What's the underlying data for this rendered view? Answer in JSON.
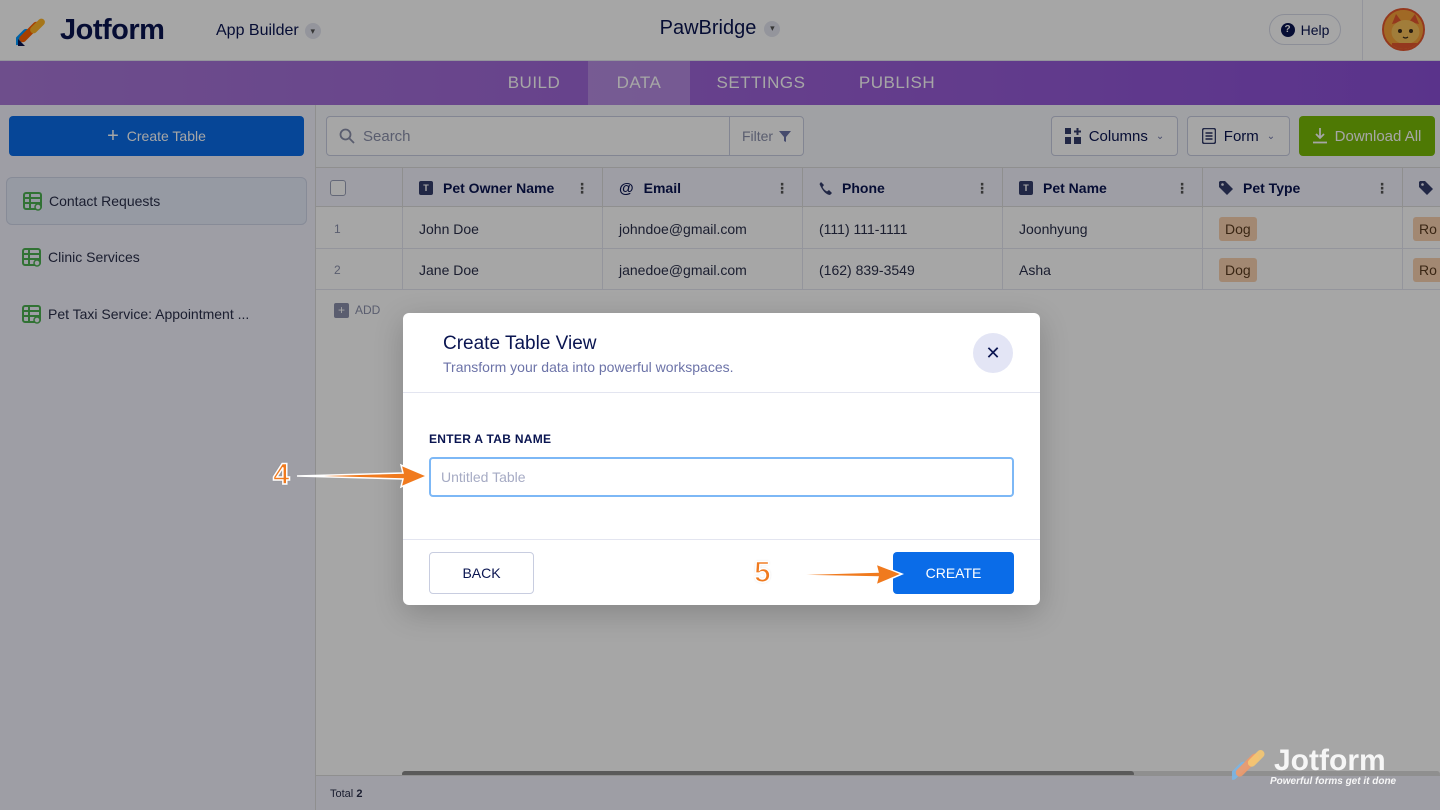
{
  "header": {
    "logo_text": "Jotform",
    "app_builder_label": "App Builder",
    "app_title": "PawBridge",
    "help_label": "Help"
  },
  "nav": {
    "tabs": [
      {
        "label": "BUILD"
      },
      {
        "label": "DATA"
      },
      {
        "label": "SETTINGS"
      },
      {
        "label": "PUBLISH"
      }
    ],
    "active": "DATA"
  },
  "sidebar": {
    "create_table_label": "Create Table",
    "items": [
      {
        "label": "Contact Requests"
      },
      {
        "label": "Clinic Services"
      },
      {
        "label": "Pet Taxi Service: Appointment ..."
      }
    ]
  },
  "toolbar": {
    "search_placeholder": "Search",
    "filter_label": "Filter",
    "columns_label": "Columns",
    "form_label": "Form",
    "download_label": "Download All"
  },
  "table": {
    "columns": [
      {
        "label": "Pet Owner Name",
        "icon": "text-type-icon"
      },
      {
        "label": "Email",
        "icon": "at-icon"
      },
      {
        "label": "Phone",
        "icon": "phone-icon"
      },
      {
        "label": "Pet Name",
        "icon": "text-type-icon"
      },
      {
        "label": "Pet Type",
        "icon": "tag-icon"
      }
    ],
    "rows": [
      {
        "num": "1",
        "owner": "John Doe",
        "email": "johndoe@gmail.com",
        "phone": "(111) 111-1111",
        "pet_name": "Joonhyung",
        "pet_type": "Dog",
        "extra": "Ro"
      },
      {
        "num": "2",
        "owner": "Jane Doe",
        "email": "janedoe@gmail.com",
        "phone": "(162) 839-3549",
        "pet_name": "Asha",
        "pet_type": "Dog",
        "extra": "Ro"
      }
    ],
    "add_label": "ADD",
    "total_label": "Total",
    "total_value": "2"
  },
  "modal": {
    "title": "Create Table View",
    "subtitle": "Transform your data into powerful workspaces.",
    "field_label": "ENTER A TAB NAME",
    "input_placeholder": "Untitled Table",
    "input_value": "",
    "back_label": "BACK",
    "create_label": "CREATE"
  },
  "annotations": {
    "step_4": "4",
    "step_5": "5",
    "arrow_color": "#f07a1e"
  },
  "watermark": {
    "text": "Jotform",
    "tagline": "Powerful forms get it done"
  },
  "colors": {
    "primary_blue": "#0a6ce8",
    "download_green": "#78bb07",
    "nav_purple": "#9a5fd8",
    "tag_orange": "#f9d2b0"
  }
}
